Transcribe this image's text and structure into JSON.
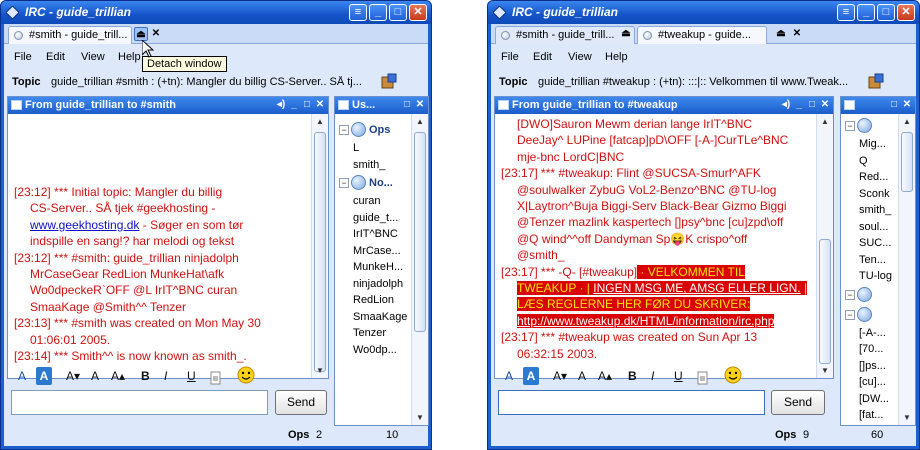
{
  "windows": [
    {
      "title": "IRC - guide_trillian",
      "tabs": [
        {
          "label": "#smith - guide_trill...",
          "active": true
        }
      ],
      "tooltip": "Detach window",
      "menu": [
        "File",
        "Edit",
        "View",
        "Help"
      ],
      "topic_label": "Topic",
      "topic_text": "guide_trillian #smith : (+tn): Mangler du billig CS-Server.. SÅ tj...",
      "chat_header": "From guide_trillian to #smith",
      "users_header": "Us...",
      "chat_lines": [
        {
          "text": "[23:12] *** Initial topic: Mangler du billig",
          "cont": false
        },
        {
          "text": "CS-Server.. SÅ tjek #geekhosting -",
          "cont": true
        },
        {
          "pre": "",
          "link": "www.geekhosting.dk",
          "post": " - Søger en som tør",
          "cont": true
        },
        {
          "text": "indspille en sang!? har melodi og tekst",
          "cont": true
        },
        {
          "text": "[23:12] *** #smith: guide_trillian ninjadolph",
          "cont": false
        },
        {
          "text": "MrCaseGear RedLion MunkeHat\\afk",
          "cont": true
        },
        {
          "text": "Wo0dpeckeR`OFF @L IrIT^BNC curan",
          "cont": true
        },
        {
          "text": "SmaaKage @Smith^^ Tenzer",
          "cont": true
        },
        {
          "text": "[23:13] *** #smith was created on Mon May 30",
          "cont": false
        },
        {
          "text": "01:06:01 2005.",
          "cont": true
        },
        {
          "text": "[23:14] *** Smith^^ is now known as smith_.",
          "cont": false
        }
      ],
      "user_groups": [
        {
          "name": "Ops",
          "users": [
            "L",
            "smith_"
          ]
        },
        {
          "name": "No...",
          "users": [
            "curan",
            "guide_t...",
            "IrIT^BNC",
            "MrCase...",
            "MunkeH...",
            "ninjadolph",
            "RedLion",
            "SmaaKage",
            "Tenzer",
            "Wo0dp..."
          ]
        }
      ],
      "input_value": "",
      "send_label": "Send",
      "status": {
        "ops_label": "Ops",
        "ops_count": "2",
        "user_count": "10"
      }
    },
    {
      "title": "IRC - guide_trillian",
      "tabs": [
        {
          "label": "#smith - guide_trill...",
          "active": false
        },
        {
          "label": "#tweakup - guide...",
          "active": true
        }
      ],
      "menu": [
        "File",
        "Edit",
        "View",
        "Help"
      ],
      "topic_label": "Topic",
      "topic_text": "guide_trillian #tweakup : (+tn): :::|:: Velkommen til www.Tweak...",
      "chat_header": "From guide_trillian to #tweakup",
      "users_header": "",
      "chat_lines": [
        {
          "text": "[DWO]Sauron Mewm derian lange IrIT^BNC",
          "cont": true
        },
        {
          "text": "DeeJay^ LUPine [fatcap]pD\\OFF [-A-]CurTLe^BNC",
          "cont": true
        },
        {
          "text": "mje-bnc LordC|BNC",
          "cont": true
        },
        {
          "text": "[23:17] *** #tweakup: Flint @SUCSA-Smurf^AFK",
          "cont": false
        },
        {
          "text": "@soulwalker ZybuG VoL2-Benzo^BNC @TU-log",
          "cont": true
        },
        {
          "text": "X|Laytron^Buja Biggi-Serv Black-Bear Gizmo Biggi",
          "cont": true
        },
        {
          "text": "@Tenzer mazlink kaspertech []psy^bnc [cu]zpd\\off",
          "cont": true
        },
        {
          "text": "@Q wind^^off Dandyman Sp",
          "emoji": "😝",
          "post": "K crispo^off",
          "cont": true
        },
        {
          "text": "@smith_",
          "cont": true
        },
        {
          "text": "[23:17] *** -Q- [#tweakup]",
          "hl": " · VELKOMMEN TIL",
          "cont": false
        },
        {
          "hl_pre": "TWEAKUP · | ",
          "hl_u": "INGEN MSG ME, AMSG ELLER LIGN.",
          "hl_post": " |",
          "cont": true
        },
        {
          "hl": "LÆS REGLERNE HER FØR DU SKRIVER:",
          "cont": true
        },
        {
          "hl_link": "http://www.tweakup.dk/HTML/information/irc.php",
          "cont": true
        },
        {
          "text": "[23:17] *** #tweakup was created on Sun Apr 13",
          "cont": false
        },
        {
          "text": "06:32:15 2003.",
          "cont": true
        }
      ],
      "user_groups": [
        {
          "name": "",
          "users": [
            "Mig...",
            "Q",
            "Red...",
            "Sconk",
            "smith_",
            "soul...",
            "SUC...",
            "Ten...",
            "TU-log"
          ]
        },
        {
          "name": "",
          "users": [
            "[-A-...",
            "[70...",
            "[]ps...",
            "[cu]...",
            "[DW...",
            "[fat..."
          ]
        }
      ],
      "input_value": "",
      "send_label": "Send",
      "status": {
        "ops_label": "Ops",
        "ops_count": "9",
        "user_count": "60"
      }
    }
  ],
  "format_buttons": [
    "A",
    "A",
    "A▾",
    "A",
    "A▴",
    "B",
    "I",
    "U"
  ],
  "colors": {
    "title_blue": "#1554c8",
    "chat_red": "#d01010",
    "highlight_red": "#d80000",
    "highlight_yellow": "#ffe600"
  }
}
